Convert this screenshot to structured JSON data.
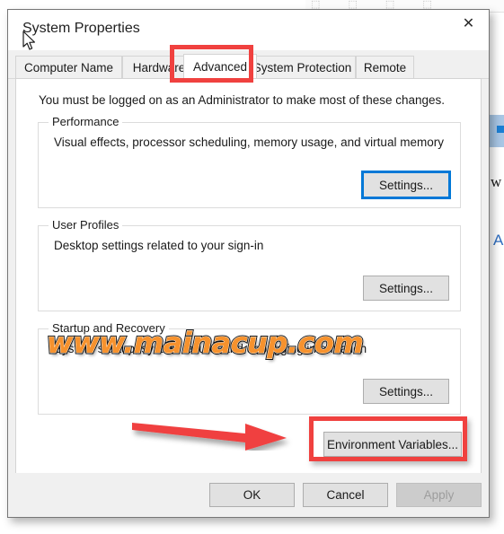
{
  "window": {
    "title": "System Properties",
    "close_label": "✕"
  },
  "tabs": [
    {
      "label": "Computer Name",
      "active": false
    },
    {
      "label": "Hardware",
      "active": false
    },
    {
      "label": "Advanced",
      "active": true
    },
    {
      "label": "System Protection",
      "active": false
    },
    {
      "label": "Remote",
      "active": false
    }
  ],
  "page": {
    "intro": "You must be logged on as an Administrator to make most of these changes.",
    "groups": [
      {
        "label": "Performance",
        "description": "Visual effects, processor scheduling, memory usage, and virtual memory",
        "button": "Settings...",
        "button_focused": true
      },
      {
        "label": "User Profiles",
        "description": "Desktop settings related to your sign-in",
        "button": "Settings...",
        "button_focused": false
      },
      {
        "label": "Startup and Recovery",
        "description": "System startup, system failure, and debugging information",
        "button": "Settings...",
        "button_focused": false
      }
    ],
    "environment_variables_button": "Environment Variables..."
  },
  "footer": {
    "ok": "OK",
    "cancel": "Cancel",
    "apply": "Apply",
    "apply_disabled": true
  },
  "annotations": {
    "watermark_text": "www.mainacup.com",
    "highlight_color": "#f0413f",
    "arrow_color": "#f0413f",
    "watermark_color": "#f6922e",
    "focus_color": "#0078d7"
  },
  "background": {
    "toolbar_glyphs": "⬚ ⬚ ⬚ ⬚",
    "letter_w": "w",
    "letter_a": "A"
  }
}
